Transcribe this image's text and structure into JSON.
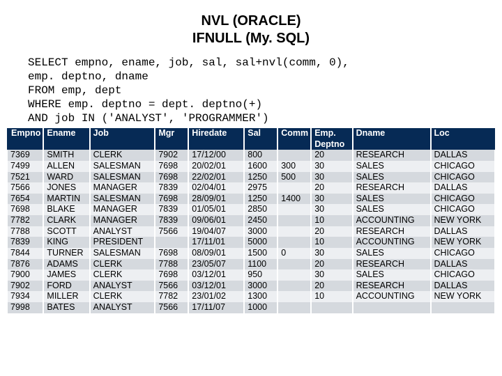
{
  "title_line1": "NVL (ORACLE)",
  "title_line2": "IFNULL (My. SQL)",
  "sql": "SELECT empno, ename, job, sal, sal+nvl(comm, 0),\nemp. deptno, dname\nFROM emp, dept\nWHERE emp. deptno = dept. deptno(+)\nAND job IN ('ANALYST', 'PROGRAMMER')",
  "columns": [
    "Empno",
    "Ename",
    "Job",
    "Mgr",
    "Hiredate",
    "Sal",
    "Comm",
    "Emp. Deptno",
    "Dname",
    "Loc"
  ],
  "rows": [
    {
      "empno": "7369",
      "ename": "SMITH",
      "job": "CLERK",
      "mgr": "7902",
      "hiredate": "17/12/00",
      "sal": "800",
      "comm": "",
      "deptno": "20",
      "dname": "RESEARCH",
      "loc": "DALLAS"
    },
    {
      "empno": "7499",
      "ename": "ALLEN",
      "job": "SALESMAN",
      "mgr": "7698",
      "hiredate": "20/02/01",
      "sal": "1600",
      "comm": "300",
      "deptno": "30",
      "dname": "SALES",
      "loc": "CHICAGO"
    },
    {
      "empno": "7521",
      "ename": "WARD",
      "job": "SALESMAN",
      "mgr": "7698",
      "hiredate": "22/02/01",
      "sal": "1250",
      "comm": "500",
      "deptno": "30",
      "dname": "SALES",
      "loc": "CHICAGO"
    },
    {
      "empno": "7566",
      "ename": "JONES",
      "job": "MANAGER",
      "mgr": "7839",
      "hiredate": "02/04/01",
      "sal": "2975",
      "comm": "",
      "deptno": "20",
      "dname": "RESEARCH",
      "loc": "DALLAS"
    },
    {
      "empno": "7654",
      "ename": "MARTIN",
      "job": "SALESMAN",
      "mgr": "7698",
      "hiredate": "28/09/01",
      "sal": "1250",
      "comm": "1400",
      "deptno": "30",
      "dname": "SALES",
      "loc": "CHICAGO"
    },
    {
      "empno": "7698",
      "ename": "BLAKE",
      "job": "MANAGER",
      "mgr": "7839",
      "hiredate": "01/05/01",
      "sal": "2850",
      "comm": "",
      "deptno": "30",
      "dname": "SALES",
      "loc": "CHICAGO"
    },
    {
      "empno": "7782",
      "ename": "CLARK",
      "job": "MANAGER",
      "mgr": "7839",
      "hiredate": "09/06/01",
      "sal": "2450",
      "comm": "",
      "deptno": "10",
      "dname": "ACCOUNTING",
      "loc": "NEW YORK"
    },
    {
      "empno": "7788",
      "ename": "SCOTT",
      "job": "ANALYST",
      "mgr": "7566",
      "hiredate": "19/04/07",
      "sal": "3000",
      "comm": "",
      "deptno": "20",
      "dname": "RESEARCH",
      "loc": "DALLAS"
    },
    {
      "empno": "7839",
      "ename": "KING",
      "job": "PRESIDENT",
      "mgr": "",
      "hiredate": "17/11/01",
      "sal": "5000",
      "comm": "",
      "deptno": "10",
      "dname": "ACCOUNTING",
      "loc": "NEW YORK"
    },
    {
      "empno": "7844",
      "ename": "TURNER",
      "job": "SALESMAN",
      "mgr": "7698",
      "hiredate": "08/09/01",
      "sal": "1500",
      "comm": "0",
      "deptno": "30",
      "dname": "SALES",
      "loc": "CHICAGO"
    },
    {
      "empno": "7876",
      "ename": "ADAMS",
      "job": "CLERK",
      "mgr": "7788",
      "hiredate": "23/05/07",
      "sal": "1100",
      "comm": "",
      "deptno": "20",
      "dname": "RESEARCH",
      "loc": "DALLAS"
    },
    {
      "empno": "7900",
      "ename": "JAMES",
      "job": "CLERK",
      "mgr": "7698",
      "hiredate": "03/12/01",
      "sal": "950",
      "comm": "",
      "deptno": "30",
      "dname": "SALES",
      "loc": "CHICAGO"
    },
    {
      "empno": "7902",
      "ename": "FORD",
      "job": "ANALYST",
      "mgr": "7566",
      "hiredate": "03/12/01",
      "sal": "3000",
      "comm": "",
      "deptno": "20",
      "dname": "RESEARCH",
      "loc": "DALLAS"
    },
    {
      "empno": "7934",
      "ename": "MILLER",
      "job": "CLERK",
      "mgr": "7782",
      "hiredate": "23/01/02",
      "sal": "1300",
      "comm": "",
      "deptno": "10",
      "dname": "ACCOUNTING",
      "loc": "NEW YORK"
    },
    {
      "empno": "7998",
      "ename": "BATES",
      "job": "ANALYST",
      "mgr": "7566",
      "hiredate": "17/11/07",
      "sal": "1000",
      "comm": "",
      "deptno": "",
      "dname": "",
      "loc": ""
    }
  ],
  "chart_data": {
    "type": "table",
    "columns": [
      "Empno",
      "Ename",
      "Job",
      "Mgr",
      "Hiredate",
      "Sal",
      "Comm",
      "Emp. Deptno",
      "Dname",
      "Loc"
    ],
    "rows": [
      [
        7369,
        "SMITH",
        "CLERK",
        7902,
        "17/12/00",
        800,
        null,
        20,
        "RESEARCH",
        "DALLAS"
      ],
      [
        7499,
        "ALLEN",
        "SALESMAN",
        7698,
        "20/02/01",
        1600,
        300,
        30,
        "SALES",
        "CHICAGO"
      ],
      [
        7521,
        "WARD",
        "SALESMAN",
        7698,
        "22/02/01",
        1250,
        500,
        30,
        "SALES",
        "CHICAGO"
      ],
      [
        7566,
        "JONES",
        "MANAGER",
        7839,
        "02/04/01",
        2975,
        null,
        20,
        "RESEARCH",
        "DALLAS"
      ],
      [
        7654,
        "MARTIN",
        "SALESMAN",
        7698,
        "28/09/01",
        1250,
        1400,
        30,
        "SALES",
        "CHICAGO"
      ],
      [
        7698,
        "BLAKE",
        "MANAGER",
        7839,
        "01/05/01",
        2850,
        null,
        30,
        "SALES",
        "CHICAGO"
      ],
      [
        7782,
        "CLARK",
        "MANAGER",
        7839,
        "09/06/01",
        2450,
        null,
        10,
        "ACCOUNTING",
        "NEW YORK"
      ],
      [
        7788,
        "SCOTT",
        "ANALYST",
        7566,
        "19/04/07",
        3000,
        null,
        20,
        "RESEARCH",
        "DALLAS"
      ],
      [
        7839,
        "KING",
        "PRESIDENT",
        null,
        "17/11/01",
        5000,
        null,
        10,
        "ACCOUNTING",
        "NEW YORK"
      ],
      [
        7844,
        "TURNER",
        "SALESMAN",
        7698,
        "08/09/01",
        1500,
        0,
        30,
        "SALES",
        "CHICAGO"
      ],
      [
        7876,
        "ADAMS",
        "CLERK",
        7788,
        "23/05/07",
        1100,
        null,
        20,
        "RESEARCH",
        "DALLAS"
      ],
      [
        7900,
        "JAMES",
        "CLERK",
        7698,
        "03/12/01",
        950,
        null,
        30,
        "SALES",
        "CHICAGO"
      ],
      [
        7902,
        "FORD",
        "ANALYST",
        7566,
        "03/12/01",
        3000,
        null,
        20,
        "RESEARCH",
        "DALLAS"
      ],
      [
        7934,
        "MILLER",
        "CLERK",
        7782,
        "23/01/02",
        1300,
        null,
        10,
        "ACCOUNTING",
        "NEW YORK"
      ],
      [
        7998,
        "BATES",
        "ANALYST",
        7566,
        "17/11/07",
        1000,
        null,
        null,
        null,
        null
      ]
    ]
  }
}
